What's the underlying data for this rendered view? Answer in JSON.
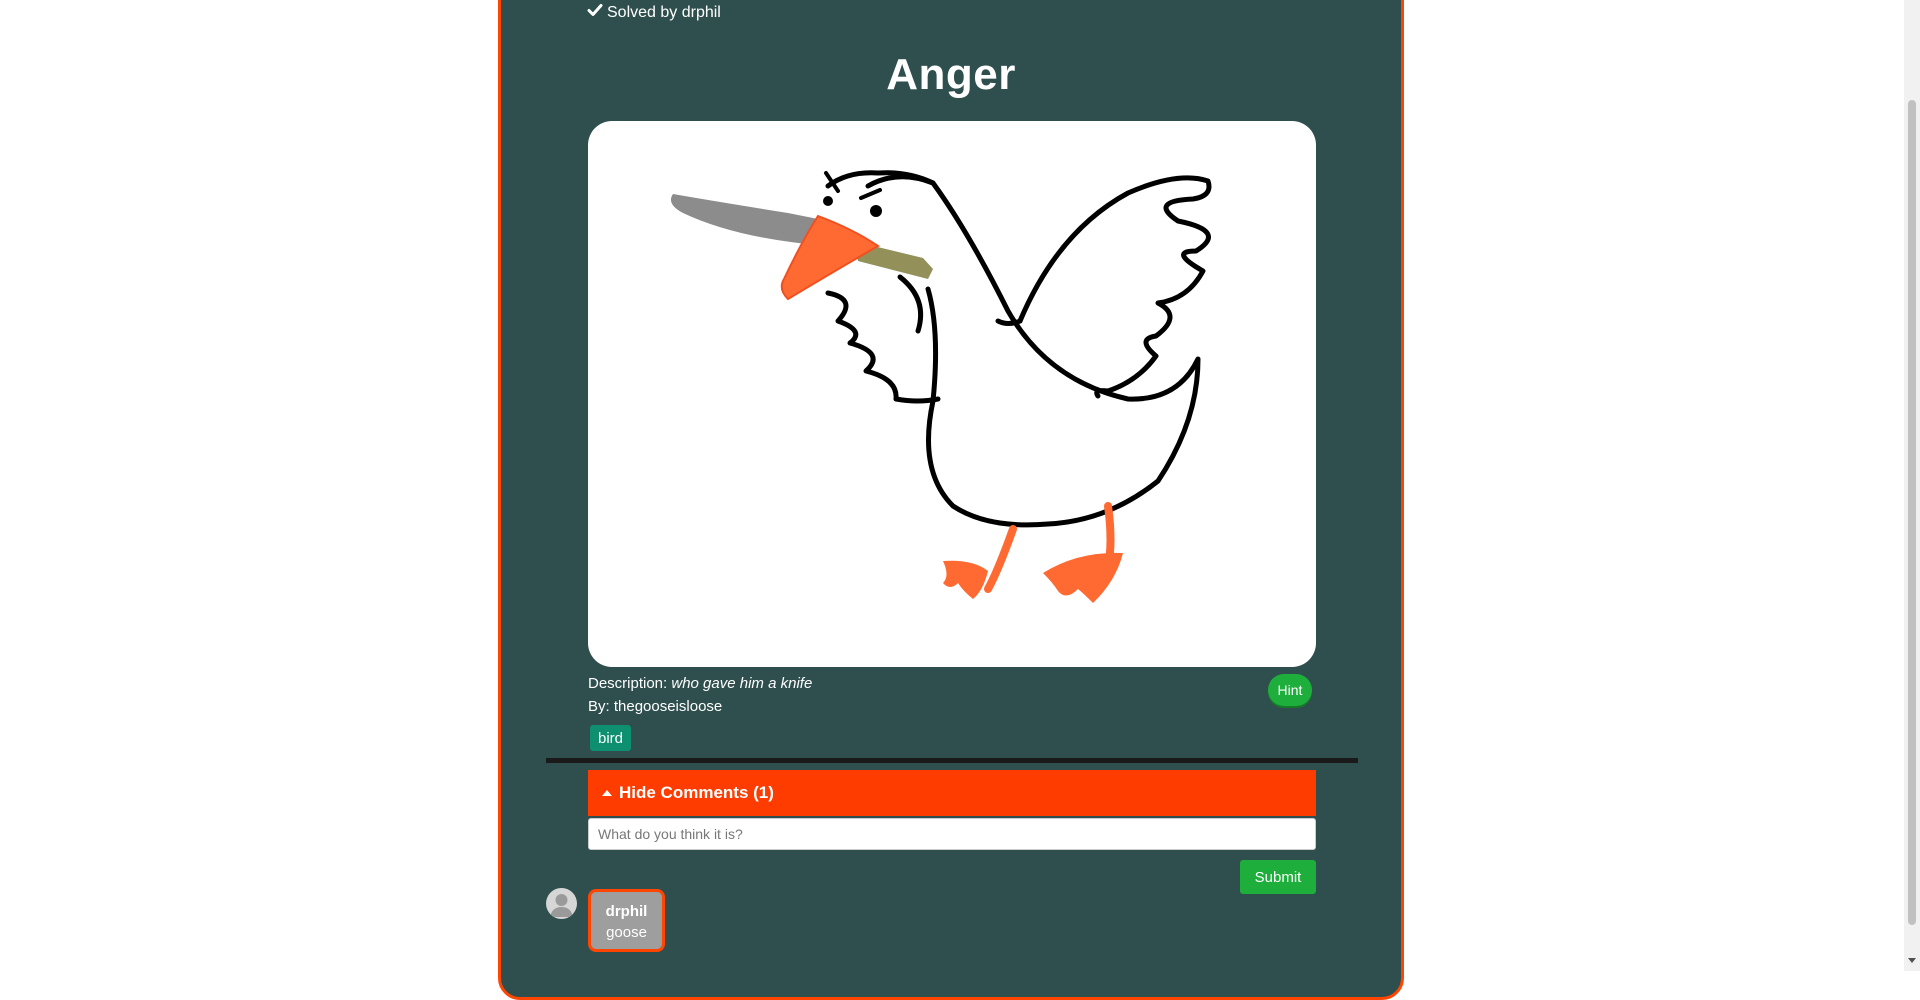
{
  "post": {
    "solved_text": "Solved by drphil",
    "title": "Anger",
    "description_label": "Description:",
    "description_value": "who gave him a knife",
    "by_text": "By: thegooseisloose",
    "hint_label": "Hint",
    "tags": [
      "bird"
    ]
  },
  "comments": {
    "toggle_label": "Hide Comments (1)",
    "input_placeholder": "What do you think it is?",
    "submit_label": "Submit",
    "items": [
      {
        "user": "drphil",
        "text": "goose"
      }
    ]
  },
  "icons": {
    "solved": "check-icon",
    "toggle": "caret-up-icon",
    "avatar": "user-silhouette-icon"
  },
  "colors": {
    "card_bg": "#2f4f4f",
    "card_border": "#ff4500",
    "accent_orange": "#ff3c00",
    "button_green": "#1eae3b",
    "tag_teal": "#0e8f6f"
  }
}
